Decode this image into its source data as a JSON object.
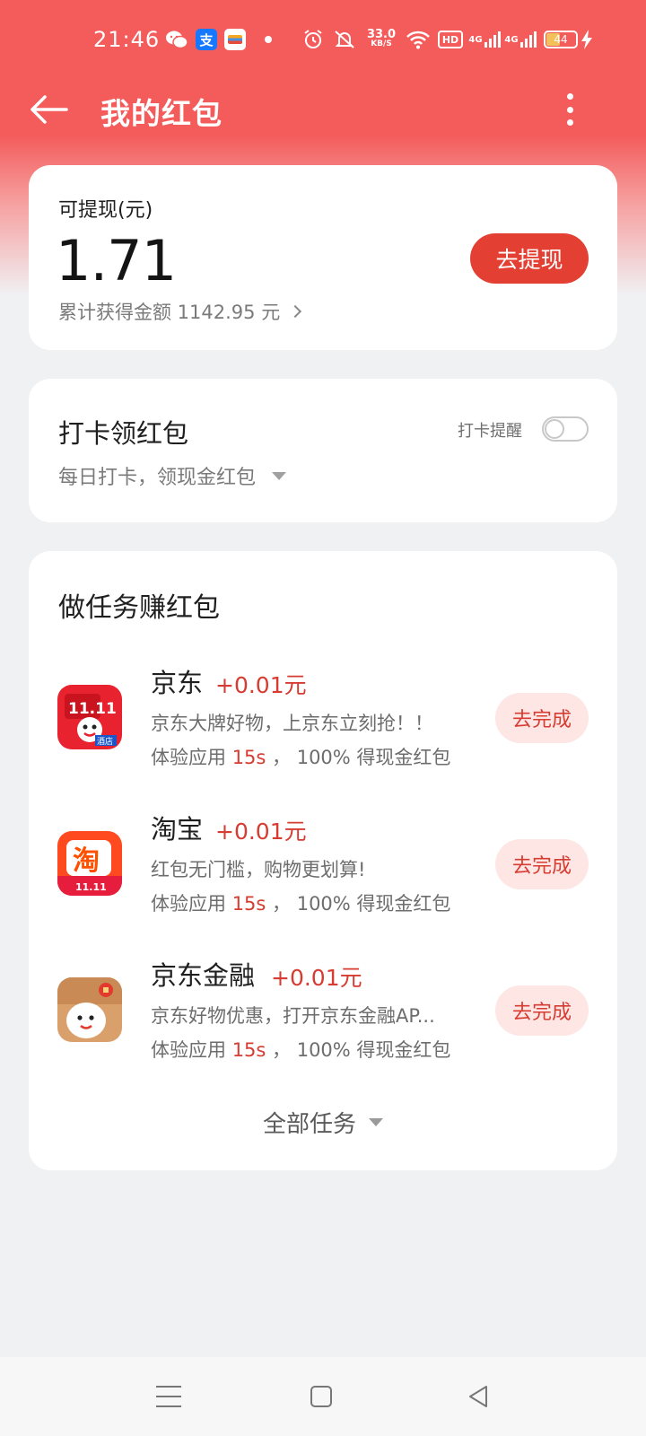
{
  "status_bar": {
    "time": "21:46",
    "alipay_glyph": "支",
    "net_speed_value": "33.0",
    "net_speed_unit": "KB/S",
    "hd_label": "HD",
    "sim1_label": "4G",
    "sim2_label": "4G",
    "battery": "44",
    "icons": [
      "wechat-icon",
      "alipay-icon",
      "wallet-icon",
      "dot-icon",
      "alarm-icon",
      "mute-icon",
      "wifi-icon",
      "signal-icon",
      "battery-icon",
      "charging-icon"
    ]
  },
  "header": {
    "title": "我的红包",
    "back_icon": "arrow-left-icon",
    "more_icon": "more-vertical-icon"
  },
  "balance": {
    "label": "可提现(元)",
    "amount": "1.71",
    "total_label": "累计获得金额 1142.95 元",
    "withdraw_label": "去提现"
  },
  "checkin": {
    "title": "打卡领红包",
    "subtitle": "每日打卡，领现金红包",
    "remind_label": "打卡提醒",
    "remind_on": false
  },
  "tasks": {
    "title": "做任务赚红包",
    "items": [
      {
        "name": "京东",
        "reward": "+0.01元",
        "desc": "京东大牌好物，上京东立刻抢！！",
        "meta_prefix": "体验应用 ",
        "meta_duration": "15s",
        "meta_suffix": " ， 100% 得现金红包",
        "button": "去完成",
        "icon": "jd-app-icon",
        "icon_text": "11.11",
        "icon_badge": "酒店"
      },
      {
        "name": "淘宝",
        "reward": "+0.01元",
        "desc": "红包无门槛，购物更划算!",
        "meta_prefix": "体验应用 ",
        "meta_duration": "15s",
        "meta_suffix": " ， 100% 得现金红包",
        "button": "去完成",
        "icon": "taobao-app-icon",
        "icon_text": "淘",
        "icon_badge": "11.11"
      },
      {
        "name": "京东金融",
        "reward": "+0.01元",
        "desc": "京东好物优惠，打开京东金融AP...",
        "meta_prefix": "体验应用 ",
        "meta_duration": "15s",
        "meta_suffix": " ， 100% 得现金红包",
        "button": "去完成",
        "icon": "jd-finance-app-icon"
      }
    ],
    "all_label": "全部任务"
  },
  "nav": {
    "icons": [
      "menu-icon",
      "home-icon",
      "back-triangle-icon"
    ]
  },
  "colors": {
    "brand_red": "#f45b5b",
    "button_red": "#e33f33",
    "accent_text": "#d63c31",
    "soft_button_bg": "#fde6e4"
  }
}
